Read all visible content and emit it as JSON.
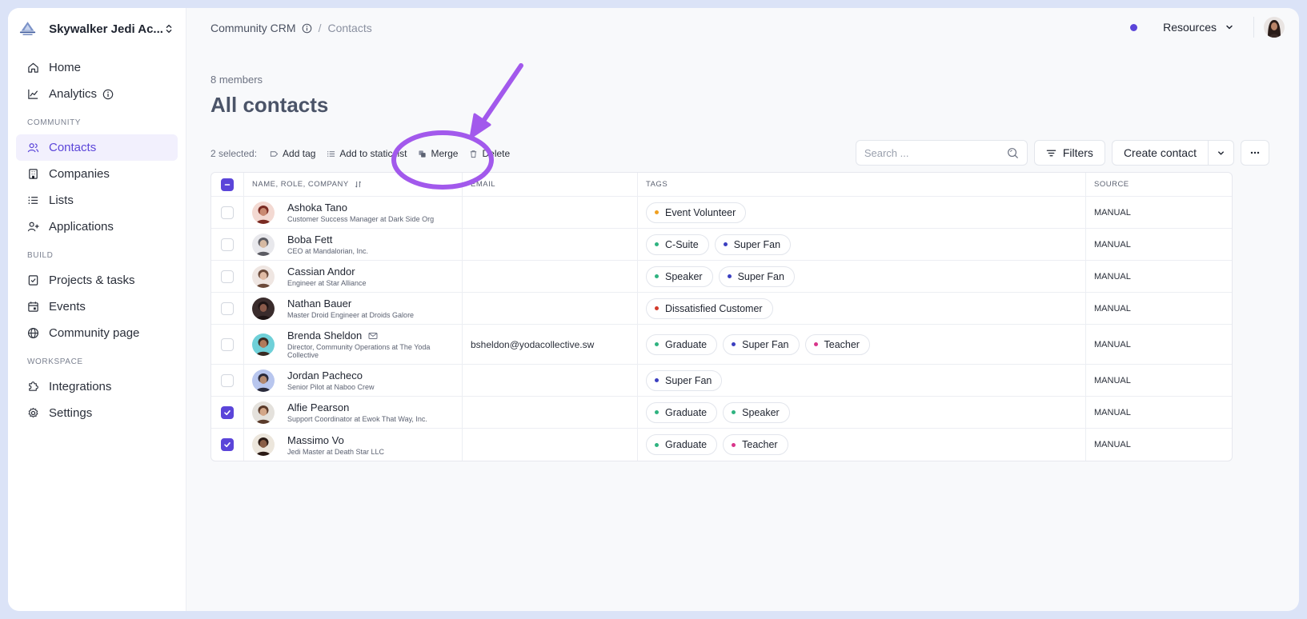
{
  "workspace": {
    "name": "Skywalker Jedi Ac..."
  },
  "sidebar": {
    "items_top": [
      {
        "label": "Home"
      },
      {
        "label": "Analytics"
      }
    ],
    "sections": [
      {
        "label": "COMMUNITY",
        "items": [
          {
            "label": "Contacts",
            "active": true
          },
          {
            "label": "Companies"
          },
          {
            "label": "Lists"
          },
          {
            "label": "Applications"
          }
        ]
      },
      {
        "label": "BUILD",
        "items": [
          {
            "label": "Projects & tasks"
          },
          {
            "label": "Events"
          },
          {
            "label": "Community page"
          }
        ]
      },
      {
        "label": "WORKSPACE",
        "items": [
          {
            "label": "Integrations"
          },
          {
            "label": "Settings"
          }
        ]
      }
    ]
  },
  "breadcrumb": {
    "root": "Community CRM",
    "separator": "/",
    "current": "Contacts"
  },
  "topbar": {
    "resources_label": "Resources"
  },
  "page": {
    "count": "8 members",
    "title": "All contacts"
  },
  "bulk": {
    "selected": "2 selected:",
    "add_tag": "Add tag",
    "add_to_static_list": "Add to static list",
    "merge": "Merge",
    "delete": "Delete"
  },
  "toolbar": {
    "search_placeholder": "Search ...",
    "filters": "Filters",
    "create_contact": "Create contact"
  },
  "table": {
    "headers": {
      "name": "NAME, ROLE, COMPANY",
      "email": "EMAIL",
      "tags": "TAGS",
      "source": "SOURCE"
    },
    "rows": [
      {
        "name": "Ashoka Tano",
        "role": "Customer Success Manager at Dark Side Org",
        "email": "",
        "source": "MANUAL",
        "checked": false,
        "tags": [
          {
            "label": "Event Volunteer",
            "color": "#f0a020"
          }
        ]
      },
      {
        "name": "Boba Fett",
        "role": "CEO at Mandalorian, Inc.",
        "email": "",
        "source": "MANUAL",
        "checked": false,
        "tags": [
          {
            "label": "C-Suite",
            "color": "#2fb380"
          },
          {
            "label": "Super Fan",
            "color": "#3b3fc0"
          }
        ]
      },
      {
        "name": "Cassian Andor",
        "role": "Engineer at Star Alliance",
        "email": "",
        "source": "MANUAL",
        "checked": false,
        "tags": [
          {
            "label": "Speaker",
            "color": "#2fb380"
          },
          {
            "label": "Super Fan",
            "color": "#3b3fc0"
          }
        ]
      },
      {
        "name": "Nathan Bauer",
        "role": "Master Droid Engineer at Droids Galore",
        "email": "",
        "source": "MANUAL",
        "checked": false,
        "tags": [
          {
            "label": "Dissatisfied Customer",
            "color": "#d23a2a"
          }
        ]
      },
      {
        "name": "Brenda Sheldon",
        "role": "Director, Community Operations at The Yoda Collective",
        "email": "bsheldon@yodacollective.sw",
        "source": "MANUAL",
        "checked": false,
        "tags": [
          {
            "label": "Graduate",
            "color": "#2fb380"
          },
          {
            "label": "Super Fan",
            "color": "#3b3fc0"
          },
          {
            "label": "Teacher",
            "color": "#d8358a"
          }
        ]
      },
      {
        "name": "Jordan Pacheco",
        "role": "Senior Pilot at Naboo Crew",
        "email": "",
        "source": "MANUAL",
        "checked": false,
        "tags": [
          {
            "label": "Super Fan",
            "color": "#3b3fc0"
          }
        ]
      },
      {
        "name": "Alfie Pearson",
        "role": "Support Coordinator at Ewok That Way, Inc.",
        "email": "",
        "source": "MANUAL",
        "checked": true,
        "tags": [
          {
            "label": "Graduate",
            "color": "#2fb380"
          },
          {
            "label": "Speaker",
            "color": "#2fb380"
          }
        ]
      },
      {
        "name": "Massimo Vo",
        "role": "Jedi Master at Death Star LLC",
        "email": "",
        "source": "MANUAL",
        "checked": true,
        "tags": [
          {
            "label": "Graduate",
            "color": "#2fb380"
          },
          {
            "label": "Teacher",
            "color": "#d8358a"
          }
        ]
      }
    ]
  },
  "colors": {
    "accent": "#5b45d9",
    "annotation": "#a259ec"
  }
}
